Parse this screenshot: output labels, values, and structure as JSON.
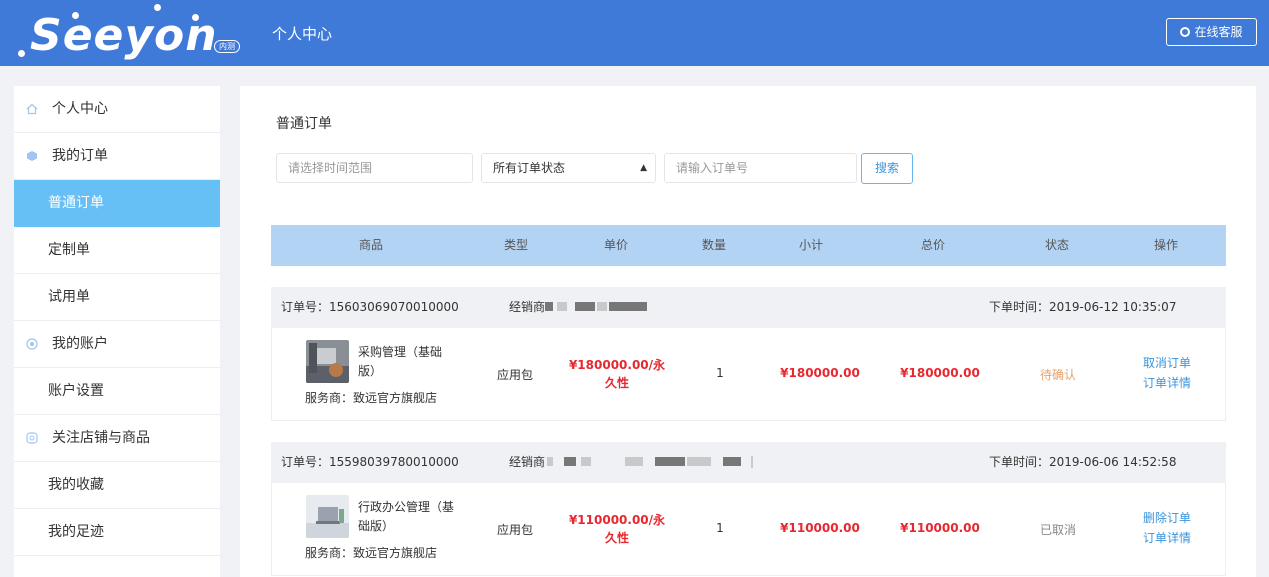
{
  "header": {
    "logo_text": "Seeyon",
    "logo_badge": "内测",
    "title": "个人中心",
    "service_button": "在线客服"
  },
  "sidebar": {
    "items": [
      {
        "label": "个人中心",
        "icon": "home-icon"
      },
      {
        "label": "我的订单",
        "icon": "cube-icon"
      },
      {
        "label": "普通订单",
        "active": true
      },
      {
        "label": "定制单"
      },
      {
        "label": "试用单"
      },
      {
        "label": "我的账户",
        "icon": "account-icon"
      },
      {
        "label": "账户设置"
      },
      {
        "label": "关注店铺与商品",
        "icon": "store-icon"
      },
      {
        "label": "我的收藏"
      },
      {
        "label": "我的足迹"
      }
    ]
  },
  "main": {
    "title": "普通订单",
    "filters": {
      "date_placeholder": "请选择时间范围",
      "status_value": "所有订单状态",
      "order_placeholder": "请输入订单号",
      "search_label": "搜索"
    },
    "columns": [
      "商品",
      "类型",
      "单价",
      "数量",
      "小计",
      "总价",
      "状态",
      "操作"
    ],
    "orders": [
      {
        "order_no_label": "订单号：15603069070010000",
        "dealer_label": "经销商",
        "time_label": "下单时间：2019-06-12 10:35:07",
        "product_line1": "采购管理（基础",
        "product_line2": "版）",
        "vendor": "服务商：致远官方旗舰店",
        "type": "应用包",
        "unit_price_line1": "¥180000.00/永",
        "unit_price_line2": "久性",
        "quantity": "1",
        "subtotal": "¥180000.00",
        "total": "¥180000.00",
        "status": "待确认",
        "status_color": "#e8a06a",
        "action1": "取消订单",
        "action2": "订单详情"
      },
      {
        "order_no_label": "订单号：15598039780010000",
        "dealer_label": "经销商",
        "time_label": "下单时间：2019-06-06 14:52:58",
        "product_line1": "行政办公管理（基",
        "product_line2": "础版）",
        "vendor": "服务商：致远官方旗舰店",
        "type": "应用包",
        "unit_price_line1": "¥110000.00/永",
        "unit_price_line2": "久性",
        "quantity": "1",
        "subtotal": "¥110000.00",
        "total": "¥110000.00",
        "status": "已取消",
        "status_color": "#888888",
        "action1": "删除订单",
        "action2": "订单详情"
      }
    ]
  },
  "colors": {
    "header_bg": "#3f7ad8",
    "active_item": "#67c0f5",
    "table_header": "#b3d3f5",
    "price_red": "#e8272f",
    "link_blue": "#3b95dc"
  }
}
